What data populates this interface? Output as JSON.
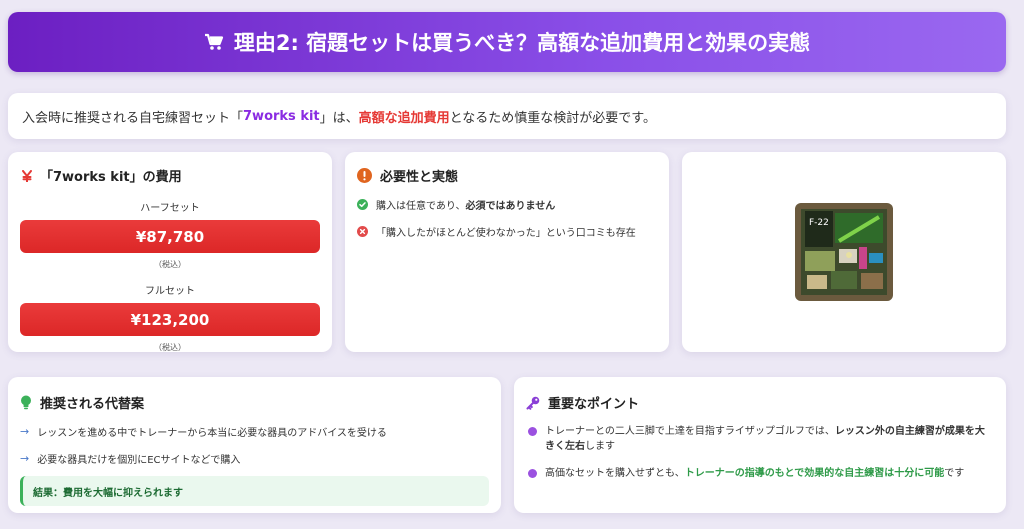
{
  "header": {
    "title": "理由2: 宿題セットは買うべき？高額な追加費用と効果の実態",
    "icon": "cart-icon"
  },
  "intro": {
    "part1": "入会時に推奨される自宅練習セット「",
    "kit_name": "7works kit",
    "part2": "」は、",
    "cost_phrase": "高額な追加費用",
    "part3": "となるため慎重な検討が必要です。"
  },
  "cost_card": {
    "title": "「7works kit」の費用",
    "icon": "yen-icon",
    "half_label": "ハーフセット",
    "half_price": "¥87,780",
    "half_tax": "（税込）",
    "full_label": "フルセット",
    "full_price": "¥123,200",
    "full_tax": "（税込）"
  },
  "necessity_card": {
    "title": "必要性と実態",
    "icon": "exclamation-icon",
    "item1_a": "購入は任意であり、",
    "item1_b": "必須ではありません",
    "item2": "「購入したがほとんど使わなかった」という口コミも存在"
  },
  "alternatives_card": {
    "title": "推奨される代替案",
    "icon": "lightbulb-icon",
    "item1": "レッスンを進める中でトレーナーから本当に必要な器具のアドバイスを受ける",
    "item2": "必要な器具だけを個別にECサイトなどで購入",
    "result": "結果：費用を大幅に抑えられます"
  },
  "key_points_card": {
    "title": "重要なポイント",
    "icon": "key-icon",
    "item1_a": "トレーナーとの二人三脚で上達を目指すライザップゴルフでは、",
    "item1_b": "レッスン外の自主練習が成果を大きく左右",
    "item1_c": "します",
    "item2_a": "高価なセットを購入せずとも、",
    "item2_b": "トレーナーの指導のもとで効果的な自主練習は十分に可能",
    "item2_c": "です"
  },
  "colors": {
    "header_gradient_start": "#6c1fc2",
    "header_gradient_end": "#9a68f0",
    "price_red": "#e53935",
    "kit_purple": "#8a2be2",
    "green_accent": "#2e9a48"
  }
}
